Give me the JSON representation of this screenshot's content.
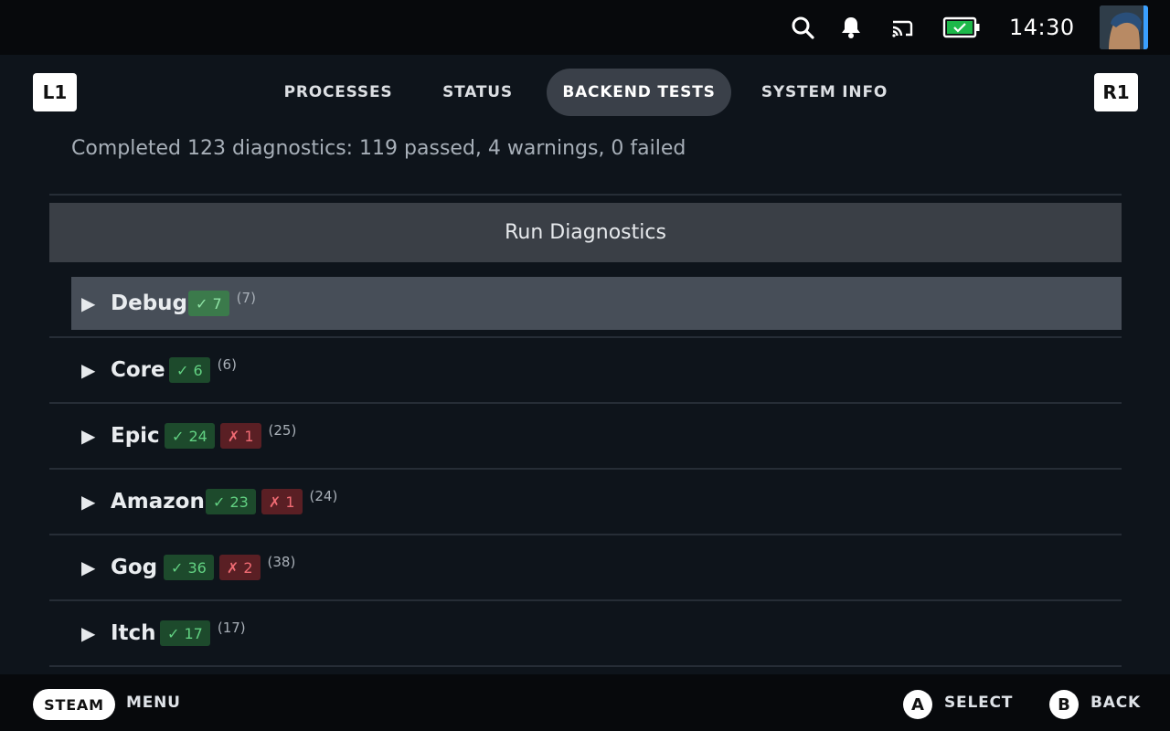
{
  "status_bar": {
    "time": "14:30",
    "icons": [
      "search-icon",
      "bell-icon",
      "cast-icon",
      "battery-charging-icon",
      "avatar"
    ]
  },
  "shoulders": {
    "left": "L1",
    "right": "R1"
  },
  "tabs": [
    {
      "label": "PROCESSES",
      "active": false
    },
    {
      "label": "STATUS",
      "active": false
    },
    {
      "label": "BACKEND TESTS",
      "active": true
    },
    {
      "label": "SYSTEM INFO",
      "active": false
    }
  ],
  "summary": "Completed 123 diagnostics: 119 passed, 4 warnings, 0 failed",
  "run_button": "Run Diagnostics",
  "groups": [
    {
      "name": "Debug",
      "pass": "✓ 7",
      "fail": null,
      "count": "(7)",
      "focused": true
    },
    {
      "name": "Core",
      "pass": "✓ 6",
      "fail": null,
      "count": "(6)",
      "focused": false
    },
    {
      "name": "Epic",
      "pass": "✓ 24",
      "fail": "✗ 1",
      "count": "(25)",
      "focused": false
    },
    {
      "name": "Amazon",
      "pass": "✓ 23",
      "fail": "✗ 1",
      "count": "(24)",
      "focused": false
    },
    {
      "name": "Gog",
      "pass": "✓ 36",
      "fail": "✗ 2",
      "count": "(38)",
      "focused": false
    },
    {
      "name": "Itch",
      "pass": "✓ 17",
      "fail": null,
      "count": "(17)",
      "focused": false
    }
  ],
  "expand_glyph": "▶",
  "bottom_bar": {
    "steam": "STEAM",
    "menu": "MENU",
    "a_glyph": "A",
    "select": "SELECT",
    "b_glyph": "B",
    "back": "BACK"
  },
  "colors": {
    "background": "#0e141b",
    "topbar": "#07090c",
    "active_tab": "#3a4049",
    "pass_green": "#62d182",
    "fail_red": "#f06b73",
    "battery_green": "#1db84a"
  }
}
